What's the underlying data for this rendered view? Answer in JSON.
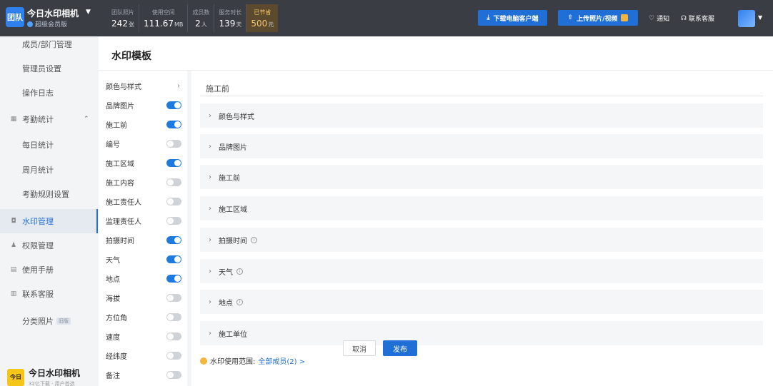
{
  "header": {
    "brand_badge": "团队",
    "brand_name": "今日水印相机",
    "brand_plan": "超级会员版",
    "stats": [
      {
        "label": "团队照片",
        "value": "242",
        "unit": "张"
      },
      {
        "label": "使用空间",
        "value": "111.67",
        "unit": "MB"
      },
      {
        "label": "成员数",
        "value": "2",
        "unit": "人"
      },
      {
        "label": "服务时长",
        "value": "139",
        "unit": "天"
      },
      {
        "label": "已节省",
        "value": "500",
        "unit": "元"
      }
    ],
    "download_button": "下载电脑客户端",
    "upload_button": "上传照片/视频",
    "notify_label": "通知",
    "service_label": "联系客服"
  },
  "sidebar": {
    "items": [
      {
        "label": "成员/部门管理"
      },
      {
        "label": "管理员设置"
      },
      {
        "label": "操作日志"
      },
      {
        "label": "考勤统计"
      },
      {
        "label": "每日统计"
      },
      {
        "label": "周月统计"
      },
      {
        "label": "考勤规则设置"
      },
      {
        "label": "水印管理"
      },
      {
        "label": "权限管理"
      },
      {
        "label": "使用手册"
      },
      {
        "label": "联系客服"
      },
      {
        "label": "分类照片",
        "tag": "旧版"
      }
    ],
    "logo_text": "今日水印相机",
    "logo_badge": "今日",
    "logo_sub": "32亿下载 · 用户首选"
  },
  "main": {
    "title": "水印模板",
    "options": [
      {
        "label": "颜色与样式",
        "type": "link"
      },
      {
        "label": "品牌图片",
        "type": "toggle",
        "on": true
      },
      {
        "label": "施工前",
        "type": "toggle",
        "on": true
      },
      {
        "label": "编号",
        "type": "toggle",
        "on": false
      },
      {
        "label": "施工区域",
        "type": "toggle",
        "on": true
      },
      {
        "label": "施工内容",
        "type": "toggle",
        "on": false
      },
      {
        "label": "施工责任人",
        "type": "toggle",
        "on": false
      },
      {
        "label": "监理责任人",
        "type": "toggle",
        "on": false
      },
      {
        "label": "拍摄时间",
        "type": "toggle",
        "on": true
      },
      {
        "label": "天气",
        "type": "toggle",
        "on": true
      },
      {
        "label": "地点",
        "type": "toggle",
        "on": true
      },
      {
        "label": "海拔",
        "type": "toggle",
        "on": false
      },
      {
        "label": "方位角",
        "type": "toggle",
        "on": false
      },
      {
        "label": "速度",
        "type": "toggle",
        "on": false
      },
      {
        "label": "经纬度",
        "type": "toggle",
        "on": false
      },
      {
        "label": "备注",
        "type": "toggle",
        "on": false
      }
    ],
    "panel_title": "施工前",
    "sections": [
      {
        "label": "颜色与样式",
        "info": false
      },
      {
        "label": "品牌图片",
        "info": false
      },
      {
        "label": "施工前",
        "info": false
      },
      {
        "label": "施工区域",
        "info": false
      },
      {
        "label": "拍摄时间",
        "info": true
      },
      {
        "label": "天气",
        "info": true
      },
      {
        "label": "地点",
        "info": true
      },
      {
        "label": "施工单位",
        "info": false
      }
    ],
    "range_label": "水印使用范围:",
    "range_value": "全部成员(2) >",
    "cancel_button": "取消",
    "publish_button": "发布"
  },
  "colors": {
    "accent": "#1f6fd6",
    "topbar": "#3a3d44",
    "toggle_on": "#1f7ae0"
  }
}
